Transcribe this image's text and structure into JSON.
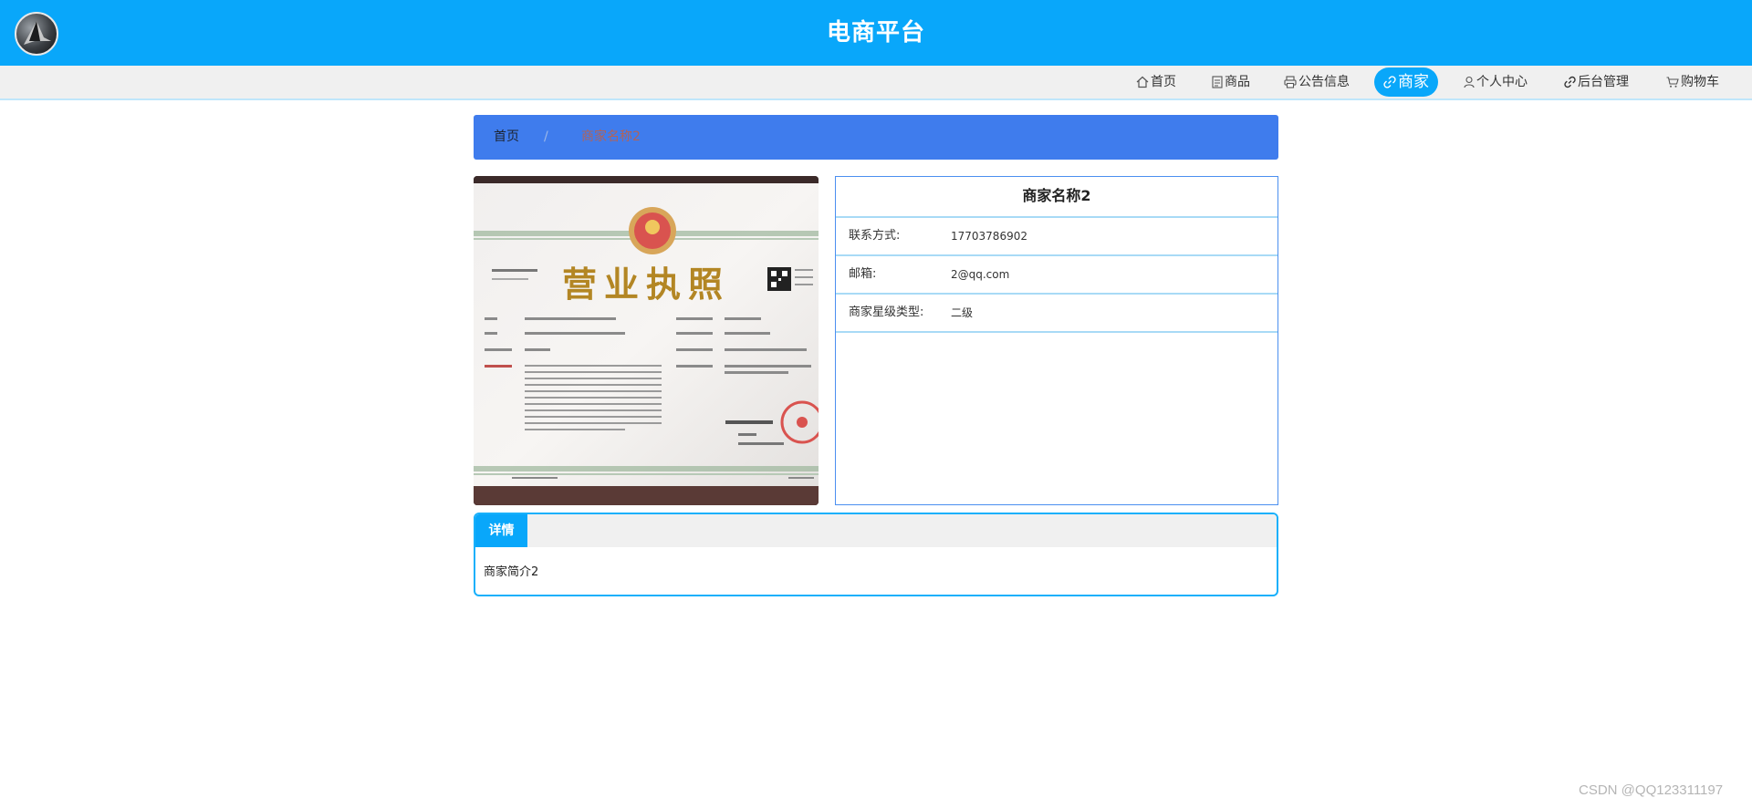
{
  "header": {
    "title": "电商平台"
  },
  "nav": {
    "items": [
      {
        "label": "首页",
        "icon": "home-icon"
      },
      {
        "label": "商品",
        "icon": "document-icon"
      },
      {
        "label": "公告信息",
        "icon": "printer-icon"
      },
      {
        "label": "商家",
        "icon": "link-icon",
        "active": true
      },
      {
        "label": "个人中心",
        "icon": "user-icon"
      },
      {
        "label": "后台管理",
        "icon": "link-icon"
      },
      {
        "label": "购物车",
        "icon": "cart-icon"
      }
    ]
  },
  "breadcrumb": {
    "home": "首页",
    "separator": "/",
    "current": "商家名称2"
  },
  "merchant": {
    "name": "商家名称2",
    "fields": [
      {
        "label": "联系方式:",
        "value": "17703786902"
      },
      {
        "label": "邮箱:",
        "value": "2@qq.com"
      },
      {
        "label": "商家星级类型:",
        "value": "二级"
      }
    ]
  },
  "license_image": {
    "title": "营业执照",
    "alt": "business-license-photo"
  },
  "detail": {
    "tab_label": "详情",
    "content": "商家简介2"
  },
  "watermark": "CSDN @QQ123311197",
  "colors": {
    "primary": "#09a7fa",
    "breadcrumb_bg": "#3f7ced",
    "nav_bg": "#f0f0f0"
  }
}
